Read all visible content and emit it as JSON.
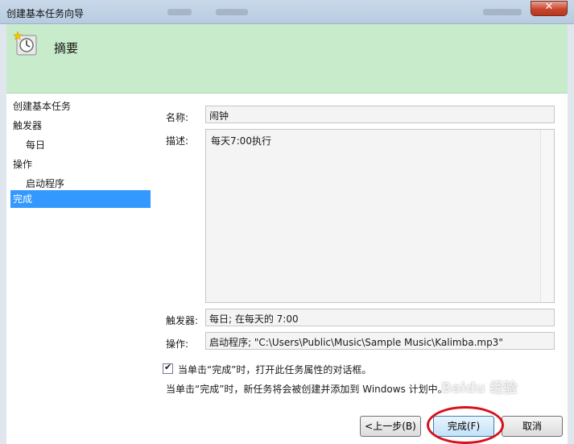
{
  "window": {
    "title": "创建基本任务向导",
    "close_label": "✕"
  },
  "header": {
    "title": "摘要",
    "icon": "clock-icon"
  },
  "nav": {
    "items": [
      {
        "label": "创建基本任务",
        "sub": false,
        "active": false
      },
      {
        "label": "触发器",
        "sub": false,
        "active": false
      },
      {
        "label": "每日",
        "sub": true,
        "active": false
      },
      {
        "label": "操作",
        "sub": false,
        "active": false
      },
      {
        "label": "启动程序",
        "sub": true,
        "active": false
      },
      {
        "label": "完成",
        "sub": false,
        "active": true
      }
    ]
  },
  "summary": {
    "name_label": "名称:",
    "name_value": "闹钟",
    "desc_label": "描述:",
    "desc_value": "每天7:00执行",
    "trigger_label": "触发器:",
    "trigger_value": "每日; 在每天的 7:00",
    "action_label": "操作:",
    "action_value": "启动程序; \"C:\\Users\\Public\\Music\\Sample Music\\Kalimba.mp3\""
  },
  "options": {
    "open_properties_checked": true,
    "open_properties_label": "当单击“完成”时，打开此任务属性的对话框。",
    "info_text": "当单击“完成”时，新任务将会被创建并添加到 Windows 计划中。"
  },
  "buttons": {
    "back_label": "<上一步(B)",
    "finish_label": "完成(F)",
    "cancel_label": "取消"
  },
  "watermark": {
    "text": "Baidu 经验"
  },
  "colors": {
    "header_bg": "#c8eccb",
    "nav_active": "#3399ff",
    "highlight_circle": "#d9101a"
  }
}
